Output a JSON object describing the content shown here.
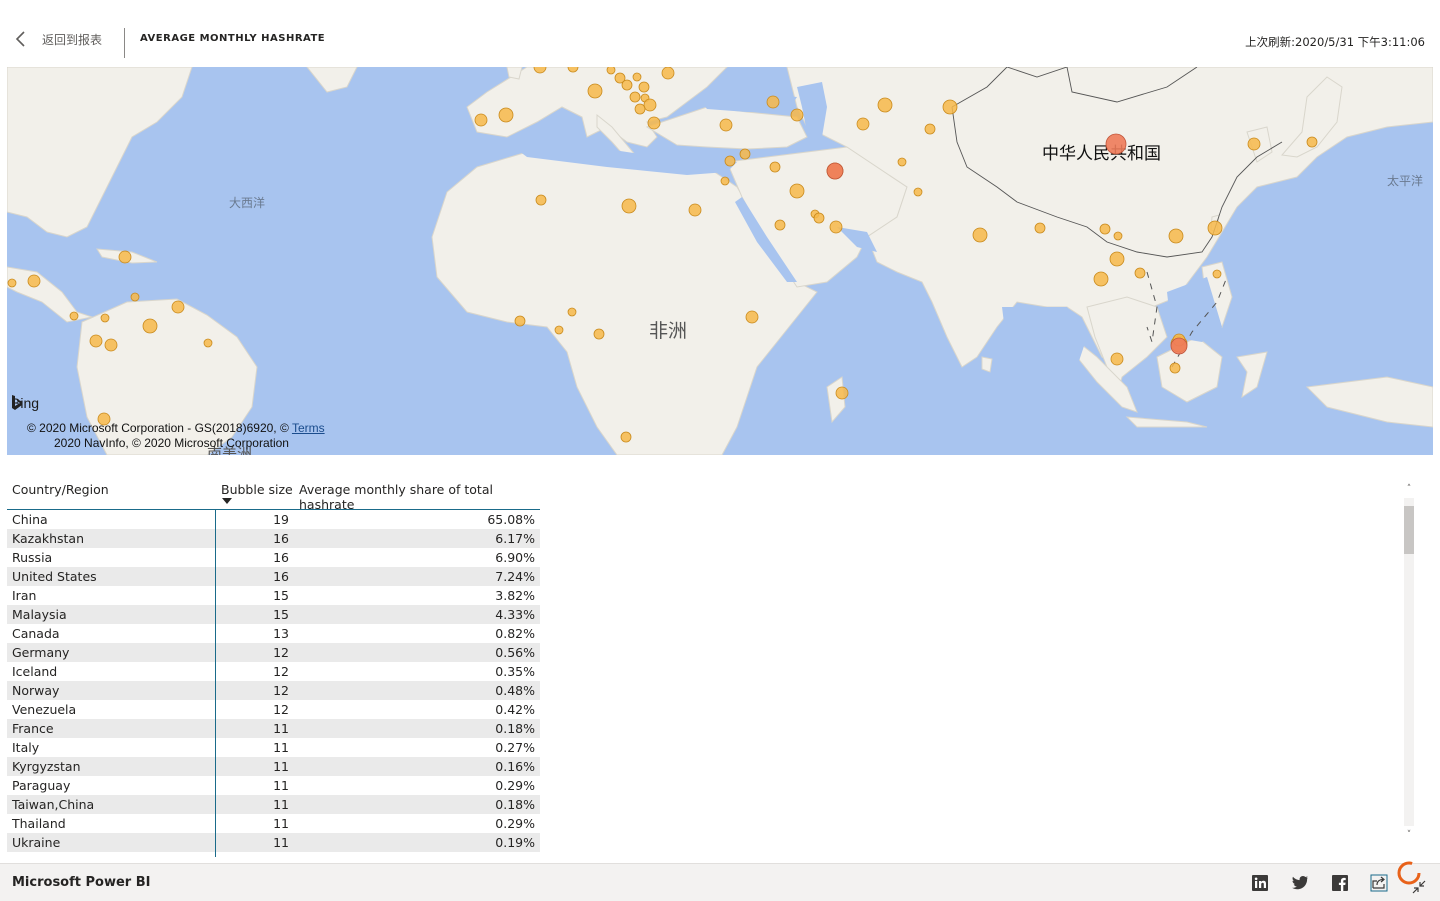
{
  "header": {
    "back_label": "返回到报表",
    "title": "AVERAGE MONTHLY HASHRATE",
    "refresh_text": "上次刷新:2020/5/31 下午3:11:06"
  },
  "map": {
    "labels": {
      "china": "中华人民共和国",
      "atlantic": "大西洋",
      "pacific": "太平洋",
      "africa": "非洲",
      "south_america": "南美洲"
    },
    "bing_label": "Bing",
    "attribution_line1": "© 2020 Microsoft Corporation - GS(2018)6920, ©",
    "terms_link": "Terms",
    "attribution_line2": "2020 NavInfo, © 2020 Microsoft Corporation"
  },
  "table": {
    "headers": [
      "Country/Region",
      "Bubble size",
      "Average monthly share of total hashrate"
    ],
    "rows": [
      {
        "country": "China",
        "bubble": "19",
        "share": "65.08%"
      },
      {
        "country": "Kazakhstan",
        "bubble": "16",
        "share": "6.17%"
      },
      {
        "country": "Russia",
        "bubble": "16",
        "share": "6.90%"
      },
      {
        "country": "United States",
        "bubble": "16",
        "share": "7.24%"
      },
      {
        "country": "Iran",
        "bubble": "15",
        "share": "3.82%"
      },
      {
        "country": "Malaysia",
        "bubble": "15",
        "share": "4.33%"
      },
      {
        "country": "Canada",
        "bubble": "13",
        "share": "0.82%"
      },
      {
        "country": "Germany",
        "bubble": "12",
        "share": "0.56%"
      },
      {
        "country": "Iceland",
        "bubble": "12",
        "share": "0.35%"
      },
      {
        "country": "Norway",
        "bubble": "12",
        "share": "0.48%"
      },
      {
        "country": "Venezuela",
        "bubble": "12",
        "share": "0.42%"
      },
      {
        "country": "France",
        "bubble": "11",
        "share": "0.18%"
      },
      {
        "country": "Italy",
        "bubble": "11",
        "share": "0.27%"
      },
      {
        "country": "Kyrgyzstan",
        "bubble": "11",
        "share": "0.16%"
      },
      {
        "country": "Paraguay",
        "bubble": "11",
        "share": "0.29%"
      },
      {
        "country": "Taiwan,China",
        "bubble": "11",
        "share": "0.18%"
      },
      {
        "country": "Thailand",
        "bubble": "11",
        "share": "0.29%"
      },
      {
        "country": "Ukraine",
        "bubble": "11",
        "share": "0.19%"
      }
    ]
  },
  "footer": {
    "brand": "Microsoft Power BI"
  },
  "colors": {
    "ocean": "#a8c4ef",
    "land": "#f2f0ea",
    "bubble": "#f7b94a",
    "bubble_large": "#ee7b5a",
    "table_accent": "#1a6b8a"
  }
}
